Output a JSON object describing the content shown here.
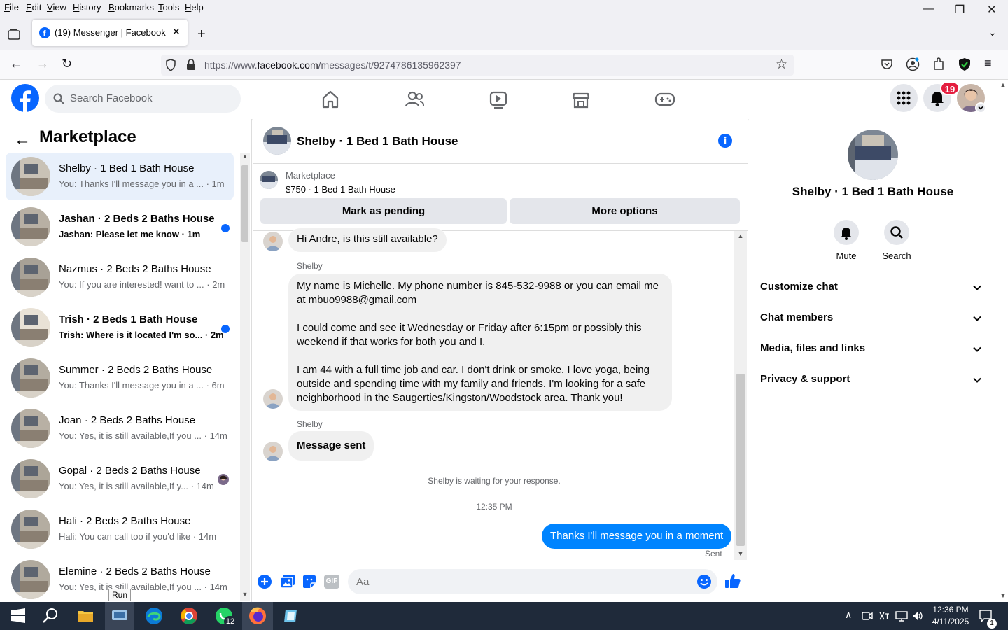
{
  "browser": {
    "menu": [
      "File",
      "Edit",
      "View",
      "History",
      "Bookmarks",
      "Tools",
      "Help"
    ],
    "tab_title": "(19) Messenger | Facebook",
    "url_prefix": "https://www.",
    "url_domain": "facebook.com",
    "url_path": "/messages/t/9274786135962397"
  },
  "fb": {
    "search_placeholder": "Search Facebook",
    "notifications_count": "19",
    "brand_color": "#0866ff"
  },
  "left": {
    "title": "Marketplace",
    "conversations": [
      {
        "name": "Shelby · 1 Bed 1 Bath House",
        "preview": "You: Thanks I'll message you in a ... · 1m",
        "unread": false,
        "active": true
      },
      {
        "name": "Jashan · 2 Beds 2 Baths House",
        "preview": "Jashan: Please let me know · 1m",
        "unread": true
      },
      {
        "name": "Nazmus · 2 Beds 2 Baths House",
        "preview": "You: If you are interested! want to ... · 2m",
        "unread": false
      },
      {
        "name": "Trish · 2 Beds 1 Bath House",
        "preview": "Trish: Where is it located I'm so... · 2m",
        "unread": true
      },
      {
        "name": "Summer · 2 Beds 2 Baths House",
        "preview": "You: Thanks I'll message you in a ... · 6m",
        "unread": false
      },
      {
        "name": "Joan · 2 Beds 2 Baths House",
        "preview": "You: Yes, it is still available,If you ... · 14m",
        "unread": false
      },
      {
        "name": "Gopal · 2 Beds 2 Baths House",
        "preview": "You: Yes, it is still available,If y... · 14m",
        "unread": false
      },
      {
        "name": "Hali · 2 Beds 2 Baths House",
        "preview": "Hali: You can call too if you'd like · 14m",
        "unread": false
      },
      {
        "name": "Elemine · 2 Beds 2 Baths House",
        "preview": "You: Yes, it is still available,If you ... · 14m",
        "unread": false
      }
    ]
  },
  "chat": {
    "title": "Shelby · 1 Bed 1 Bath House",
    "marketplace_label": "Marketplace",
    "listing": "$750 · 1 Bed 1 Bath House",
    "mark_pending": "Mark as pending",
    "more_options": "More options",
    "msg1": "Hi Andre, is this still available?",
    "sender": "Shelby",
    "msg2_p1": "My name is Michelle. My phone number is 845-532-9988 or you can email me at mbuo9988@gmail.com",
    "msg2_p2": "I could come and see it Wednesday or Friday after 6:15pm or possibly this weekend if that works for both you and I.",
    "msg2_p3": "I am 44 with a full time job and car. I don't drink or smoke. I love yoga, being outside and spending time with my family and friends. I'm looking for a safe neighborhood in the Saugerties/Kingston/Woodstock area. Thank you!",
    "msg3": "Message sent",
    "waiting": "Shelby is waiting for your response.",
    "time": "12:35 PM",
    "my_msg": "Thanks I'll message you in a moment",
    "sent": "Sent",
    "input_placeholder": "Aa",
    "gif": "GIF"
  },
  "right": {
    "title": "Shelby · 1 Bed 1 Bath House",
    "mute": "Mute",
    "search": "Search",
    "sections": [
      "Customize chat",
      "Chat members",
      "Media, files and links",
      "Privacy & support"
    ]
  },
  "taskbar": {
    "run_tooltip": "Run",
    "whatsapp_badge": "12",
    "time": "12:36 PM",
    "date": "4/11/2025",
    "notif_count": "1"
  }
}
